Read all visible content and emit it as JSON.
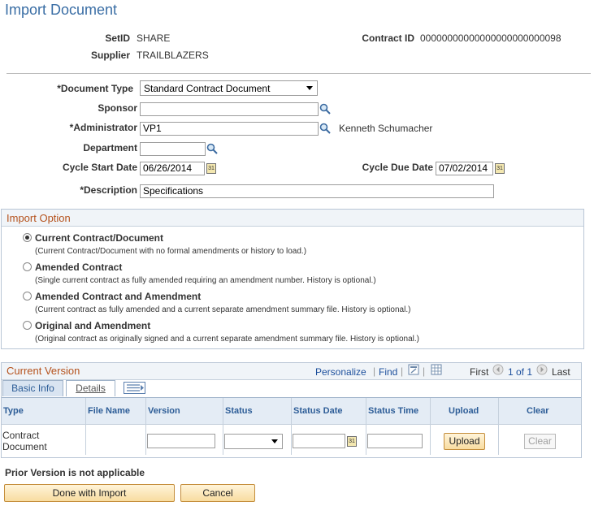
{
  "page_title": "Import Document",
  "header": {
    "setid_label": "SetID",
    "setid_value": "SHARE",
    "supplier_label": "Supplier",
    "supplier_value": "TRAILBLAZERS",
    "contract_id_label": "Contract ID",
    "contract_id_value": "00000000000000000000000098"
  },
  "form": {
    "document_type_label": "*Document Type",
    "document_type_value": "Standard Contract Document",
    "sponsor_label": "Sponsor",
    "sponsor_value": "",
    "administrator_label": "*Administrator",
    "administrator_value": "VP1",
    "administrator_name": "Kenneth Schumacher",
    "department_label": "Department",
    "department_value": "",
    "cycle_start_label": "Cycle Start Date",
    "cycle_start_value": "06/26/2014",
    "cycle_due_label": "Cycle Due Date",
    "cycle_due_value": "07/02/2014",
    "description_label": "*Description",
    "description_value": "Specifications"
  },
  "import_option": {
    "title": "Import Option",
    "options": [
      {
        "label": "Current Contract/Document",
        "desc": "(Current Contract/Document with no formal amendments or history to load.)",
        "selected": true
      },
      {
        "label": "Amended Contract",
        "desc": "(Single current contract as fully amended requiring an amendment number. History is optional.)",
        "selected": false
      },
      {
        "label": "Amended Contract and Amendment",
        "desc": "(Current contract as fully amended and a current separate amendment summary file. History is optional.)",
        "selected": false
      },
      {
        "label": "Original and Amendment",
        "desc": "(Original contract as originally signed and a current separate amendment summary file. History is optional.)",
        "selected": false
      }
    ]
  },
  "current_version": {
    "title": "Current Version",
    "personalize": "Personalize",
    "find": "Find",
    "pager_first": "First",
    "pager_count": "1 of 1",
    "pager_last": "Last",
    "tabs": [
      "Basic Info",
      "Details"
    ],
    "columns": [
      "Type",
      "File Name",
      "Version",
      "Status",
      "Status Date",
      "Status Time",
      "Upload",
      "Clear"
    ],
    "row": {
      "type": "Contract Document",
      "file_name": "",
      "version": "",
      "status": "",
      "status_date": "",
      "status_time": ""
    },
    "upload_button": "Upload",
    "clear_button": "Clear"
  },
  "footer": {
    "prior_version": "Prior Version is not applicable",
    "done_button": "Done with Import",
    "cancel_button": "Cancel"
  },
  "icons": {
    "lookup": "magnifier-icon",
    "calendar": "calendar-icon"
  },
  "colors": {
    "title": "#3a6ea5",
    "section_title": "#b5521d",
    "link": "#1c4f9c",
    "button_bg": "#f8dca0"
  }
}
